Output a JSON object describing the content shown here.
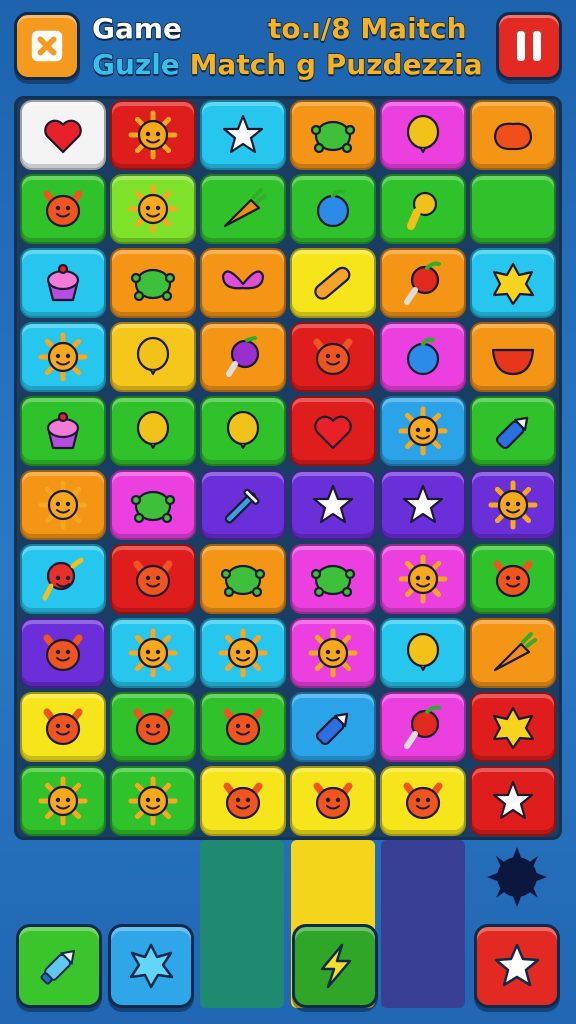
{
  "header": {
    "line1_left": "Game",
    "line1_right": "to.ı/8 Maitch",
    "line2_part1": "Guzle",
    "line2_part2": "Match g Puzdezzia"
  },
  "buttons": {
    "close_icon": "close-x-icon",
    "pause_icon": "pause-icon"
  },
  "board": {
    "rows": [
      [
        {
          "bg": "#f4f4f4",
          "icon": "heart"
        },
        {
          "bg": "#e01d1d",
          "icon": "sun"
        },
        {
          "bg": "#26c6ef",
          "icon": "star"
        },
        {
          "bg": "#f59516",
          "icon": "turtle"
        },
        {
          "bg": "#ec3fe0",
          "icon": "balloon"
        },
        {
          "bg": "#f59516",
          "icon": "blob"
        }
      ],
      [
        {
          "bg": "#30c22a",
          "icon": "monster"
        },
        {
          "bg": "#7ee22a",
          "icon": "sun"
        },
        {
          "bg": "#30c22a",
          "icon": "carrot"
        },
        {
          "bg": "#30c22a",
          "icon": "fruit"
        },
        {
          "bg": "#30c22a",
          "icon": "pear"
        },
        {
          "bg": "#30c22a",
          "icon": "none"
        }
      ],
      [
        {
          "bg": "#26c6ef",
          "icon": "cupcake"
        },
        {
          "bg": "#f59516",
          "icon": "turtle"
        },
        {
          "bg": "#f59516",
          "icon": "butterfly"
        },
        {
          "bg": "#f5e51a",
          "icon": "bread"
        },
        {
          "bg": "#f59516",
          "icon": "apple"
        },
        {
          "bg": "#26c6ef",
          "icon": "splat"
        }
      ],
      [
        {
          "bg": "#26c6ef",
          "icon": "sun"
        },
        {
          "bg": "#f5c71a",
          "icon": "balloon"
        },
        {
          "bg": "#f59516",
          "icon": "eggplant"
        },
        {
          "bg": "#e01d1d",
          "icon": "monster"
        },
        {
          "bg": "#ec3fe0",
          "icon": "fruit"
        },
        {
          "bg": "#f59516",
          "icon": "bowl"
        }
      ],
      [
        {
          "bg": "#30c22a",
          "icon": "cupcake"
        },
        {
          "bg": "#30c22a",
          "icon": "balloon"
        },
        {
          "bg": "#30c22a",
          "icon": "balloon"
        },
        {
          "bg": "#e01d1d",
          "icon": "heart"
        },
        {
          "bg": "#2aa3e8",
          "icon": "sun"
        },
        {
          "bg": "#30c22a",
          "icon": "pencil"
        }
      ],
      [
        {
          "bg": "#f59516",
          "icon": "sun"
        },
        {
          "bg": "#ec3fe0",
          "icon": "turtle"
        },
        {
          "bg": "#6a2fd8",
          "icon": "sword"
        },
        {
          "bg": "#6a2fd8",
          "icon": "star"
        },
        {
          "bg": "#6a2fd8",
          "icon": "star"
        },
        {
          "bg": "#6a2fd8",
          "icon": "sun"
        }
      ],
      [
        {
          "bg": "#26c6ef",
          "icon": "lollipop"
        },
        {
          "bg": "#e01d1d",
          "icon": "monster"
        },
        {
          "bg": "#f59516",
          "icon": "turtle"
        },
        {
          "bg": "#ec3fe0",
          "icon": "turtle"
        },
        {
          "bg": "#ec3fe0",
          "icon": "sun"
        },
        {
          "bg": "#30c22a",
          "icon": "monster"
        }
      ],
      [
        {
          "bg": "#6a2fd8",
          "icon": "monster"
        },
        {
          "bg": "#26c6ef",
          "icon": "sun"
        },
        {
          "bg": "#26c6ef",
          "icon": "sun"
        },
        {
          "bg": "#ec3fe0",
          "icon": "sun"
        },
        {
          "bg": "#26c6ef",
          "icon": "balloon"
        },
        {
          "bg": "#f59516",
          "icon": "carrot"
        }
      ],
      [
        {
          "bg": "#f5e51a",
          "icon": "monster"
        },
        {
          "bg": "#30c22a",
          "icon": "monster"
        },
        {
          "bg": "#30c22a",
          "icon": "monster"
        },
        {
          "bg": "#2aa3e8",
          "icon": "pencil"
        },
        {
          "bg": "#ec3fe0",
          "icon": "apple"
        },
        {
          "bg": "#e01d1d",
          "icon": "splat"
        }
      ],
      [
        {
          "bg": "#30c22a",
          "icon": "sun"
        },
        {
          "bg": "#30c22a",
          "icon": "sun"
        },
        {
          "bg": "#f5e51a",
          "icon": "monster"
        },
        {
          "bg": "#f5e51a",
          "icon": "monster"
        },
        {
          "bg": "#f5e51a",
          "icon": "monster"
        },
        {
          "bg": "#e01d1d",
          "icon": "star"
        }
      ]
    ],
    "icon_colors": {
      "heart": "#e8202a",
      "sun": "#f8a81c",
      "star": "#2ab8ef",
      "turtle": "#3ec03a",
      "balloon": "#f0c21a",
      "blob": "#f04e1a",
      "monster": "#f0541f",
      "carrot": "#f08a1a",
      "fruit": "#2c8be8",
      "pear": "#f2c01a",
      "cupcake": "#b84cde",
      "butterfly": "#e04ed8",
      "bread": "#f3a32a",
      "apple": "#e02a20",
      "splat": "#f6d31e",
      "eggplant": "#9a2fd0",
      "bowl": "#e8361c",
      "pencil": "#2b6fe0",
      "sword": "#3c9ee8",
      "lollipop": "#e8302a"
    }
  },
  "columns": [
    "#1f8a6f",
    "#f5d51c",
    "#3a3f96"
  ],
  "bottom_bar": {
    "slot1_icon": "pencil-icon",
    "slot2_icon": "splat-icon",
    "slot3_icon": "lightning-icon",
    "slot4_icon": "star-icon",
    "bomb_icon": "bomb-icon"
  }
}
